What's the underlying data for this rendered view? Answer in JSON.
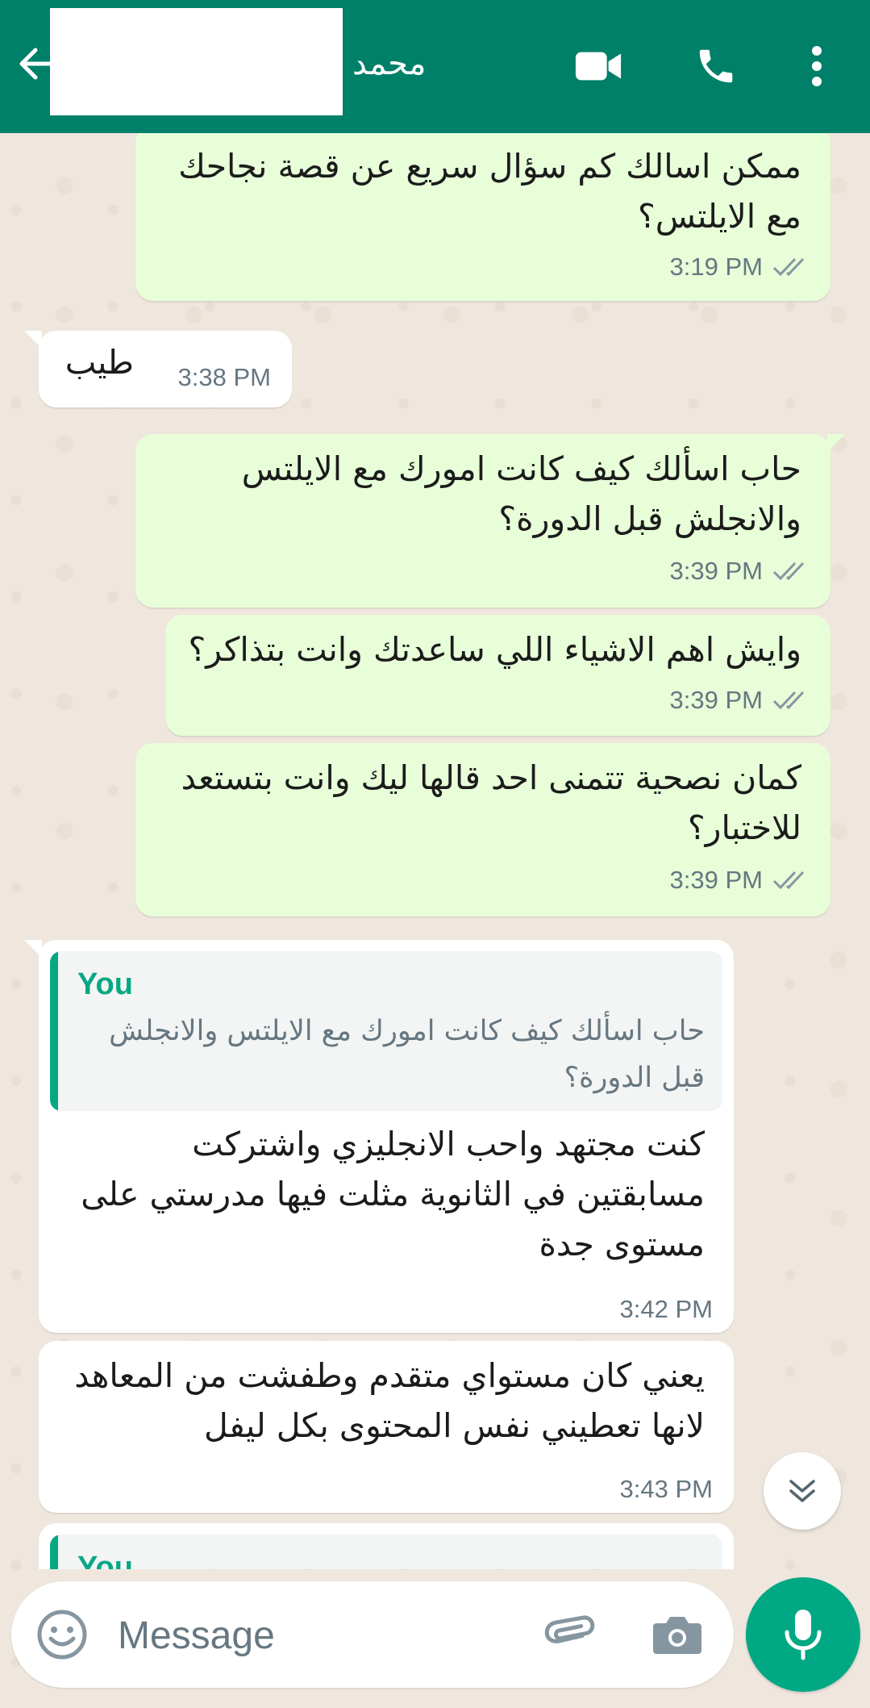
{
  "header": {
    "contact_name": "محمد",
    "icons": [
      "back-arrow-icon",
      "video-call-icon",
      "voice-call-icon",
      "more-options-icon"
    ]
  },
  "messages": [
    {
      "direction": "outgoing",
      "text": "ممكن اسالك كم سؤال سريع عن قصة نجاحك\nمع الايلتس؟",
      "time": "3:19 PM",
      "status": "read"
    },
    {
      "direction": "incoming",
      "text": "طيب",
      "time": "3:38 PM"
    },
    {
      "direction": "outgoing",
      "text": "حاب اسألك كيف كانت امورك مع الايلتس\nوالانجلش قبل الدورة؟",
      "time": "3:39 PM",
      "status": "read"
    },
    {
      "direction": "outgoing",
      "text": "وايش اهم الاشياء اللي ساعدتك وانت بتذاكر؟",
      "time": "3:39 PM",
      "status": "read"
    },
    {
      "direction": "outgoing",
      "text": "كمان نصحية تتمنى احد قالها ليك وانت بتستعد\nللاختبار؟",
      "time": "3:39 PM",
      "status": "read"
    },
    {
      "direction": "incoming",
      "quote_author": "You",
      "quote_text": "حاب اسألك كيف كانت امورك مع الايلتس والانجلش\nقبل الدورة؟",
      "text": "كنت مجتهد واحب الانجليزي واشتركت\nمسابقتين في الثانوية مثلت فيها مدرستي على\nمستوى جدة",
      "time": "3:42 PM"
    },
    {
      "direction": "incoming",
      "text": "يعني كان مستواي متقدم وطفشت من المعاهد\nلانها تعطيني نفس المحتوى بكل ليفل",
      "time": "3:43 PM"
    },
    {
      "direction": "incoming",
      "quote_author": "You",
      "partial": true
    }
  ],
  "composer": {
    "placeholder": "Message",
    "icons": [
      "emoji-icon",
      "attachment-icon",
      "camera-icon",
      "microphone-icon"
    ]
  },
  "colors": {
    "header": "#008069",
    "outgoing_bubble": "#e7fed9",
    "incoming_bubble": "#ffffff",
    "accent": "#00a884",
    "chat_background": "#efe7de"
  }
}
